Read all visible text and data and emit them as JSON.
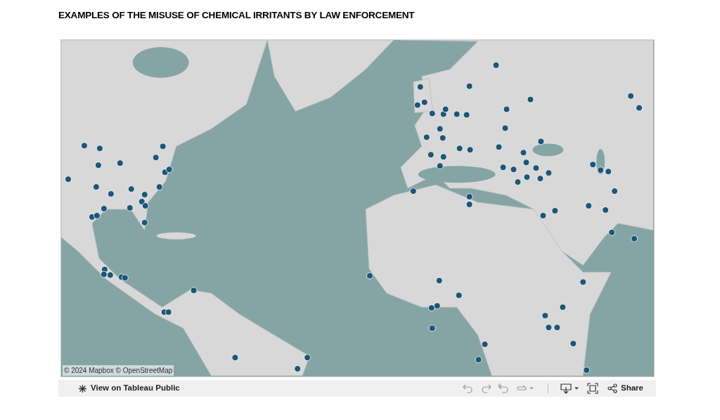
{
  "title": "EXAMPLES OF THE MISUSE OF CHEMICAL IRRITANTS BY LAW ENFORCEMENT",
  "map": {
    "kind": "picture",
    "attribution": "© 2024 Mapbox © OpenStreetMap"
  },
  "toolbar": {
    "view_link": "View on Tableau Public",
    "tools": [
      {
        "kind": "undo",
        "disabled": true
      },
      {
        "kind": "redo",
        "disabled": true
      },
      {
        "kind": "revert",
        "disabled": true
      },
      {
        "kind": "refresh",
        "disabled": true
      },
      {
        "kind": "caret",
        "disabled": true
      },
      {
        "kind": "download",
        "disabled": false
      },
      {
        "kind": "caret",
        "disabled": false
      },
      {
        "kind": "fullscreen",
        "disabled": false
      }
    ],
    "share": "Share"
  }
}
